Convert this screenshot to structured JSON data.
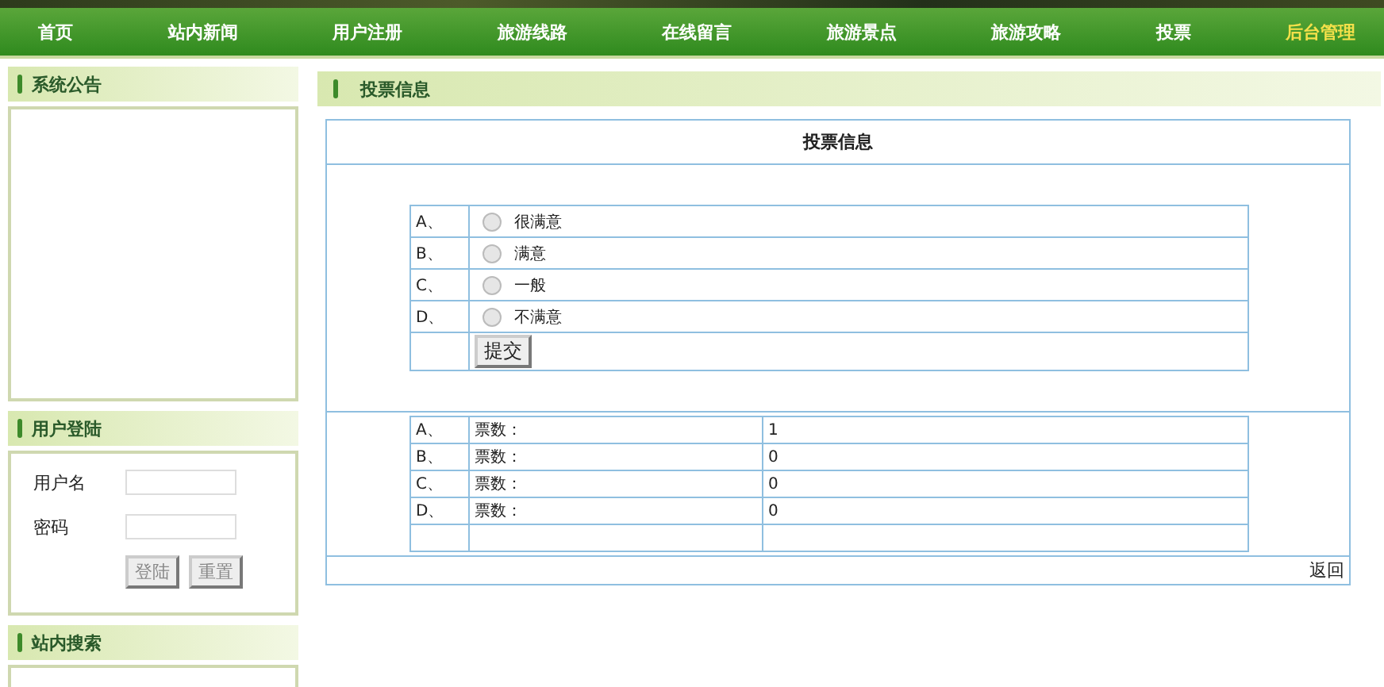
{
  "nav": [
    {
      "label": "首页",
      "hovered": false
    },
    {
      "label": "站内新闻",
      "hovered": false
    },
    {
      "label": "用户注册",
      "hovered": false
    },
    {
      "label": "旅游线路",
      "hovered": false
    },
    {
      "label": "在线留言",
      "hovered": false
    },
    {
      "label": "旅游景点",
      "hovered": false
    },
    {
      "label": "旅游攻略",
      "hovered": false
    },
    {
      "label": "投票",
      "hovered": false
    },
    {
      "label": "后台管理",
      "hovered": true
    }
  ],
  "sidebar": {
    "notice_title": "系统公告",
    "login_title": "用户登陆",
    "username_label": "用户名",
    "password_label": "密码",
    "login_button": "登陆",
    "reset_button": "重置",
    "search_title": "站内搜索"
  },
  "main": {
    "header": "投票信息",
    "title": "投票信息",
    "options": [
      {
        "letter": "A、",
        "label": "很满意",
        "selected": false
      },
      {
        "letter": "B、",
        "label": "满意",
        "selected": false
      },
      {
        "letter": "C、",
        "label": "一般",
        "selected": false
      },
      {
        "letter": "D、",
        "label": "不满意",
        "selected": false
      }
    ],
    "submit": "提交",
    "results": [
      {
        "letter": "A、",
        "label": "票数：",
        "count": "1"
      },
      {
        "letter": "B、",
        "label": "票数：",
        "count": "0"
      },
      {
        "letter": "C、",
        "label": "票数：",
        "count": "0"
      },
      {
        "letter": "D、",
        "label": "票数：",
        "count": "0"
      }
    ],
    "back": "返回"
  }
}
